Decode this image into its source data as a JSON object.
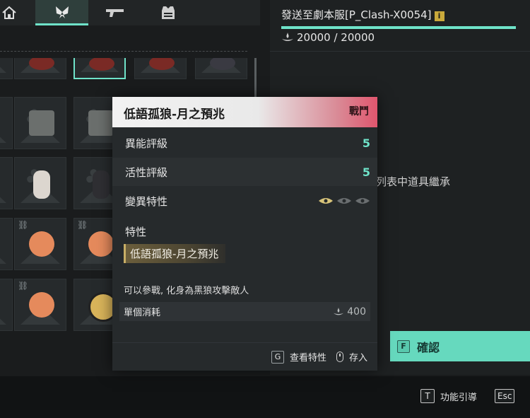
{
  "tabs": [
    {
      "icon": "home-icon"
    },
    {
      "icon": "butterfly-icon",
      "active": true
    },
    {
      "icon": "gun-icon"
    },
    {
      "icon": "armor-icon"
    }
  ],
  "right_panel": {
    "send_to": "發送至劇本服[P_Clash-X0054]",
    "info_icon_glyph": "i",
    "capacity": "20000 / 20000",
    "inherit_text": "列表中道具繼承",
    "confirm_key": "F",
    "confirm_label": "確認"
  },
  "popup": {
    "title": "低語孤狼-月之預兆",
    "tag": "戰鬥",
    "rows": [
      {
        "label": "異能評級",
        "value": "5"
      },
      {
        "label": "活性評級",
        "value": "5"
      },
      {
        "label": "變異特性"
      }
    ],
    "trait_label": "特性",
    "trait_name": "低語孤狼-月之預兆",
    "description": "可以參戰, 化身為黑狼攻擊敵人",
    "cost_label": "單個消耗",
    "cost_value": "400",
    "footer": {
      "view_key": "G",
      "view_label": "查看特性",
      "store_label": "存入"
    }
  },
  "bottom_bar": {
    "guide_key": "T",
    "guide_label": "功能引導",
    "esc_key": "Esc"
  },
  "colors": {
    "accent": "#6fe3c9",
    "tag_red": "#e0566e",
    "trait_gold": "#c8ae66",
    "confirm_bg": "#66d9be"
  }
}
